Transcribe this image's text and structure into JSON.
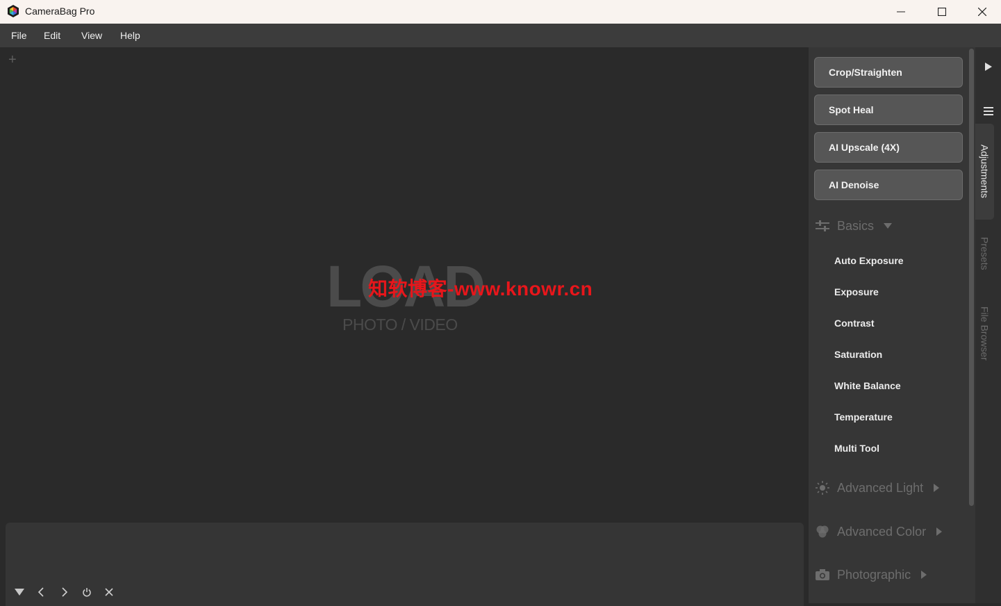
{
  "window": {
    "title": "CameraBag Pro",
    "minimize_icon": "minimize-icon",
    "maximize_icon": "maximize-icon",
    "close_icon": "close-icon"
  },
  "menu": {
    "items": [
      "File",
      "Edit",
      "View",
      "Help"
    ]
  },
  "canvas": {
    "add_tab_icon": "plus-icon",
    "load_title": "LOAD",
    "load_subtitle": "PHOTO / VIDEO",
    "watermark": "知软博客-www.knowr.cn"
  },
  "filmstrip": {
    "buttons": [
      "collapse-down-icon",
      "previous-icon",
      "next-icon",
      "power-icon",
      "close-icon"
    ]
  },
  "panel": {
    "tools": [
      "Crop/Straighten",
      "Spot Heal",
      "AI Upscale (4X)",
      "AI Denoise"
    ],
    "basics": {
      "label": "Basics",
      "icon": "sliders-icon",
      "expanded": true,
      "items": [
        "Auto Exposure",
        "Exposure",
        "Contrast",
        "Saturation",
        "White Balance",
        "Temperature",
        "Multi Tool"
      ]
    },
    "sections": [
      {
        "label": "Advanced Light",
        "icon": "sun-icon",
        "expanded": false
      },
      {
        "label": "Advanced Color",
        "icon": "color-circles-icon",
        "expanded": false
      },
      {
        "label": "Photographic",
        "icon": "camera-icon",
        "expanded": false
      }
    ]
  },
  "tabstrip": {
    "play_icon": "play-icon",
    "menu_icon": "hamburger-icon",
    "tabs": [
      {
        "label": "Adjustments",
        "active": true
      },
      {
        "label": "Presets",
        "active": false
      },
      {
        "label": "File Browser",
        "active": false
      }
    ]
  },
  "colors": {
    "canvas_bg": "#2a2a2a",
    "panel_bg": "#363636",
    "button_bg": "#565656",
    "watermark": "#e8161b",
    "titlebar_bg": "#f9f3ef"
  }
}
